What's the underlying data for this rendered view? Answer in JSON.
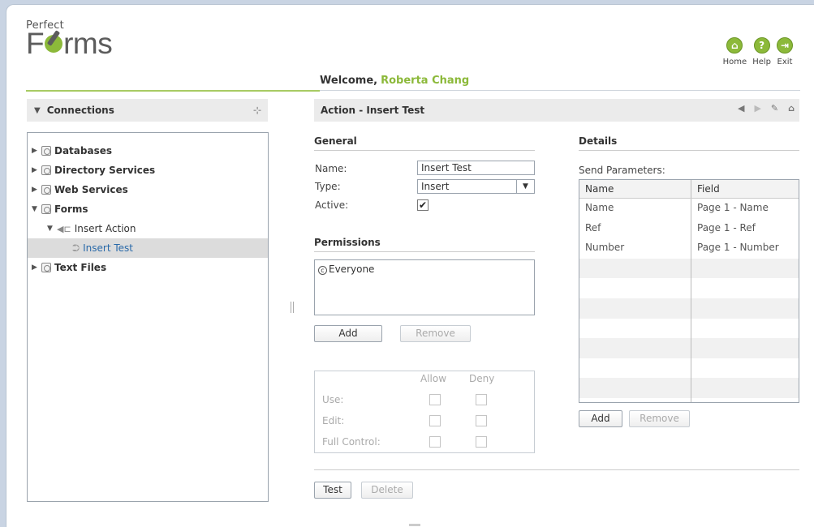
{
  "brand": {
    "perfect": "Perfect",
    "forms_pre": "F",
    "forms_post": "rms"
  },
  "header": {
    "welcome": "Welcome,",
    "user": "Roberta Chang"
  },
  "topnav": [
    {
      "label": "Home",
      "glyph": "⌂"
    },
    {
      "label": "Help",
      "glyph": "?"
    },
    {
      "label": "Exit",
      "glyph": "⇥"
    }
  ],
  "left": {
    "title": "Connections",
    "tree": [
      {
        "label": "Databases",
        "level": 0,
        "expanded": false
      },
      {
        "label": "Directory Services",
        "level": 0,
        "expanded": false
      },
      {
        "label": "Web Services",
        "level": 0,
        "expanded": false
      },
      {
        "label": "Forms",
        "level": 0,
        "expanded": true
      },
      {
        "label": "Insert Action",
        "level": 1,
        "expanded": true
      },
      {
        "label": "Insert Test",
        "level": 2,
        "selected": true
      },
      {
        "label": "Text Files",
        "level": 0,
        "expanded": false
      }
    ]
  },
  "right": {
    "title": "Action - Insert Test",
    "general": {
      "title": "General",
      "name_label": "Name:",
      "name_value": "Insert Test",
      "type_label": "Type:",
      "type_value": "Insert",
      "active_label": "Active:",
      "active_checked": true
    },
    "permissions": {
      "title": "Permissions",
      "entries": [
        "Everyone"
      ],
      "add": "Add",
      "remove": "Remove",
      "allow": "Allow",
      "deny": "Deny",
      "rows": [
        "Use:",
        "Edit:",
        "Full Control:"
      ]
    },
    "details": {
      "title": "Details",
      "send_params": "Send Parameters:",
      "columns": [
        "Name",
        "Field"
      ],
      "rows": [
        [
          "Name",
          "Page 1 - Name"
        ],
        [
          "Ref",
          "Page 1 - Ref"
        ],
        [
          "Number",
          "Page 1 - Number"
        ]
      ],
      "add": "Add",
      "remove": "Remove"
    },
    "test": "Test",
    "delete": "Delete"
  }
}
